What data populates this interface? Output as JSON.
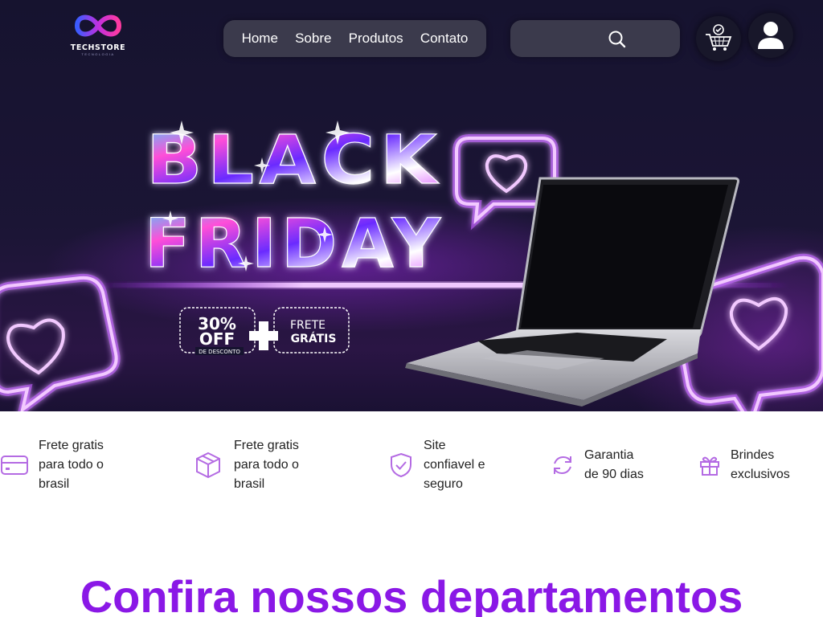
{
  "brand": {
    "name": "TECHSTORE",
    "tagline": "TECNOLOGIA"
  },
  "nav": {
    "items": [
      {
        "label": "Home"
      },
      {
        "label": "Sobre"
      },
      {
        "label": "Produtos"
      },
      {
        "label": "Contato"
      }
    ]
  },
  "search": {
    "placeholder": "",
    "icon": "search-icon"
  },
  "header_icons": {
    "cart": "shopping-cart-check-icon",
    "user": "user-icon"
  },
  "banner": {
    "line1": "BLACK",
    "line2": "FRIDAY",
    "discount_value": "30%",
    "discount_word": "OFF",
    "discount_caption": "DE DESCONTO",
    "shipping_line1": "FRETE",
    "shipping_line2": "GRÁTIS"
  },
  "features": [
    {
      "icon": "credit-card-icon",
      "text": "Frete gratis\npara todo o\nbrasil"
    },
    {
      "icon": "box-icon",
      "text": "Frete gratis\npara todo o\nbrasil"
    },
    {
      "icon": "shield-check-icon",
      "text": "Site\nconfiavel e\nseguro"
    },
    {
      "icon": "refresh-icon",
      "text": "Garantia\nde 90 dias"
    },
    {
      "icon": "gift-icon",
      "text": "Brindes\nexclusivos"
    }
  ],
  "departments": {
    "title": "Confira nossos departamentos"
  },
  "colors": {
    "accent": "#8a18e6",
    "hero_background": "#16132f",
    "nav_pill": "#3b3a4c",
    "neon": "#c15cff",
    "feature_icon": "#b46be3"
  }
}
